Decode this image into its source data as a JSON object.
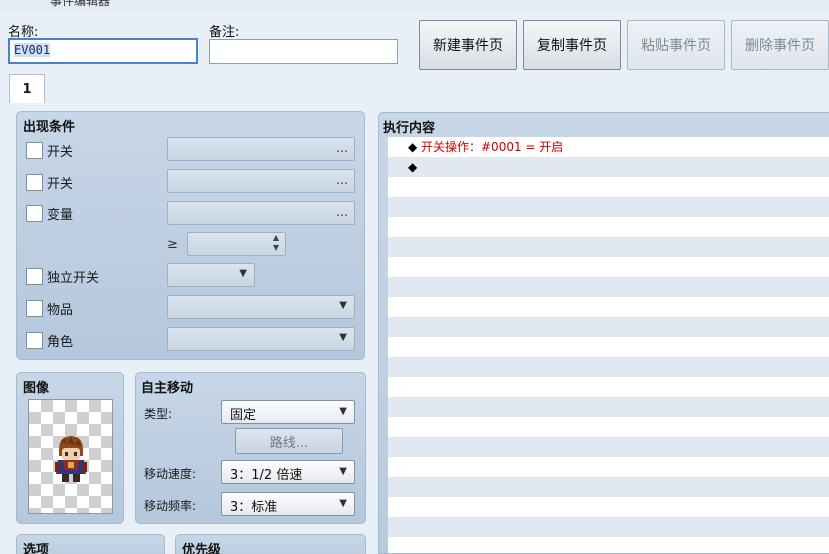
{
  "window": {
    "title": "事件编辑器"
  },
  "top": {
    "name_label": "名称:",
    "name_value": "EV001",
    "note_label": "备注:",
    "note_value": ""
  },
  "toolbar": {
    "new_page": "新建事件页",
    "copy_page": "复制事件页",
    "paste_page": "粘贴事件页",
    "delete_page": "删除事件页"
  },
  "tabs": [
    {
      "label": "1"
    }
  ],
  "conditions": {
    "title": "出现条件",
    "switch1_label": "开关",
    "switch2_label": "开关",
    "variable_label": "变量",
    "gte_symbol": "≥",
    "self_switch_label": "独立开关",
    "item_label": "物品",
    "actor_label": "角色",
    "dots": "…"
  },
  "image": {
    "title": "图像"
  },
  "autonomous": {
    "title": "自主移动",
    "type_label": "类型:",
    "type_value": "固定",
    "route_button": "路线...",
    "speed_label": "移动速度:",
    "speed_value": "3：1/2 倍速",
    "freq_label": "移动频率:",
    "freq_value": "3：标准"
  },
  "options": {
    "title": "选项"
  },
  "priority": {
    "title": "优先级"
  },
  "execution": {
    "title": "执行内容",
    "bullet": "◆",
    "commands": [
      {
        "text": "开关操作：#0001 = 开启"
      },
      {
        "text": ""
      }
    ]
  },
  "icons": {
    "checkbox": "checkbox-icon",
    "dropdown": "chevron-down-icon",
    "spinner": "spinner-icon",
    "ellipsis": "ellipsis-icon"
  }
}
